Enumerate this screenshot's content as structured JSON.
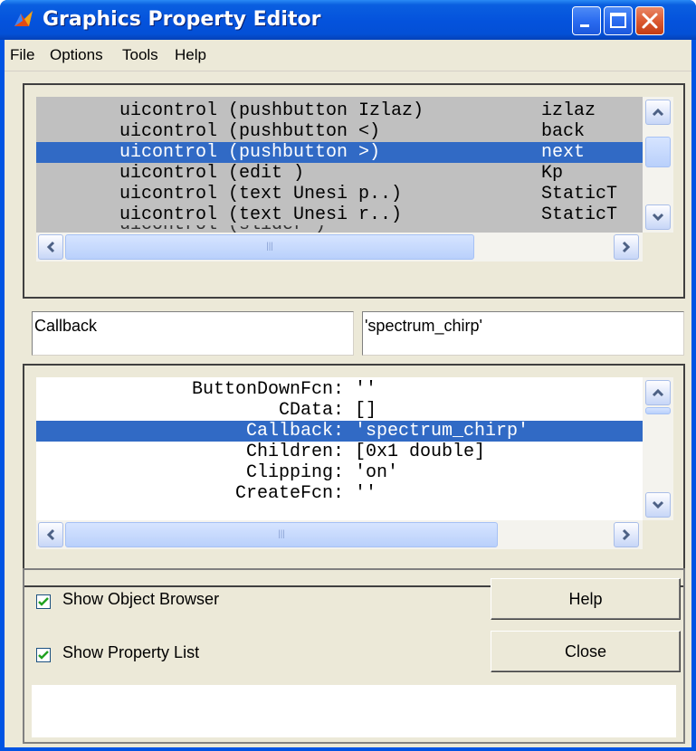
{
  "window": {
    "title": "Graphics Property Editor"
  },
  "menu": {
    "items": [
      "File",
      "Options",
      "Tools",
      "Help"
    ]
  },
  "object_browser": {
    "rows": [
      {
        "desc": "uicontrol (pushbutton Izlaz)",
        "tag": "izlaz"
      },
      {
        "desc": "uicontrol (pushbutton <)",
        "tag": "back"
      },
      {
        "desc": "uicontrol (pushbutton >)",
        "tag": "next",
        "selected": true
      },
      {
        "desc": "uicontrol (edit )",
        "tag": "Kp"
      },
      {
        "desc": "uicontrol (text Unesi p..)",
        "tag": "StaticT"
      },
      {
        "desc": "uicontrol (text Unesi r..)",
        "tag": "StaticT"
      }
    ],
    "hscroll_grip": "|||"
  },
  "property_field": {
    "name": "Callback",
    "value": "'spectrum_chirp'"
  },
  "property_list": {
    "rows": [
      {
        "name": "ButtonDownFcn:",
        "value": "''"
      },
      {
        "name": "CData:",
        "value": "[]"
      },
      {
        "name": "Callback:",
        "value": "'spectrum_chirp'",
        "selected": true
      },
      {
        "name": "Children:",
        "value": "[0x1 double]"
      },
      {
        "name": "Clipping:",
        "value": "'on'"
      },
      {
        "name": "CreateFcn:",
        "value": "''"
      }
    ],
    "hscroll_grip": "|||"
  },
  "options": {
    "show_object_browser": {
      "label": "Show Object Browser",
      "checked": true
    },
    "show_property_list": {
      "label": "Show Property List",
      "checked": true
    }
  },
  "buttons": {
    "help": "Help",
    "close": "Close"
  },
  "colors": {
    "selection": "#316ac5",
    "face": "#ece9d8",
    "list_bg": "#c0c0c0",
    "titlebar": "#0452dc"
  }
}
